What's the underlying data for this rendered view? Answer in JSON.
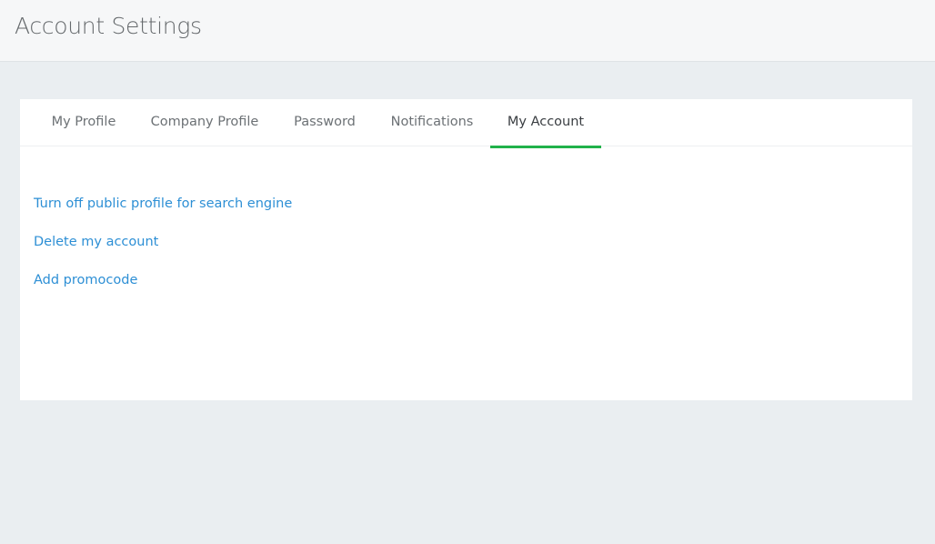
{
  "header": {
    "title": "Account Settings"
  },
  "tabs": [
    {
      "label": "My Profile"
    },
    {
      "label": "Company Profile"
    },
    {
      "label": "Password"
    },
    {
      "label": "Notifications"
    },
    {
      "label": "My Account"
    }
  ],
  "active_tab": "My Account",
  "content": {
    "links": [
      {
        "label": "Turn off public profile for search engine"
      },
      {
        "label": "Delete my account"
      },
      {
        "label": "Add promocode"
      }
    ]
  },
  "colors": {
    "background": "#eaeef1",
    "header_background": "#f6f7f8",
    "link": "#2d8fd5",
    "active_tab_underline": "#21b24a",
    "tab_text": "#6c7175",
    "active_tab_text": "#3a3e42"
  }
}
